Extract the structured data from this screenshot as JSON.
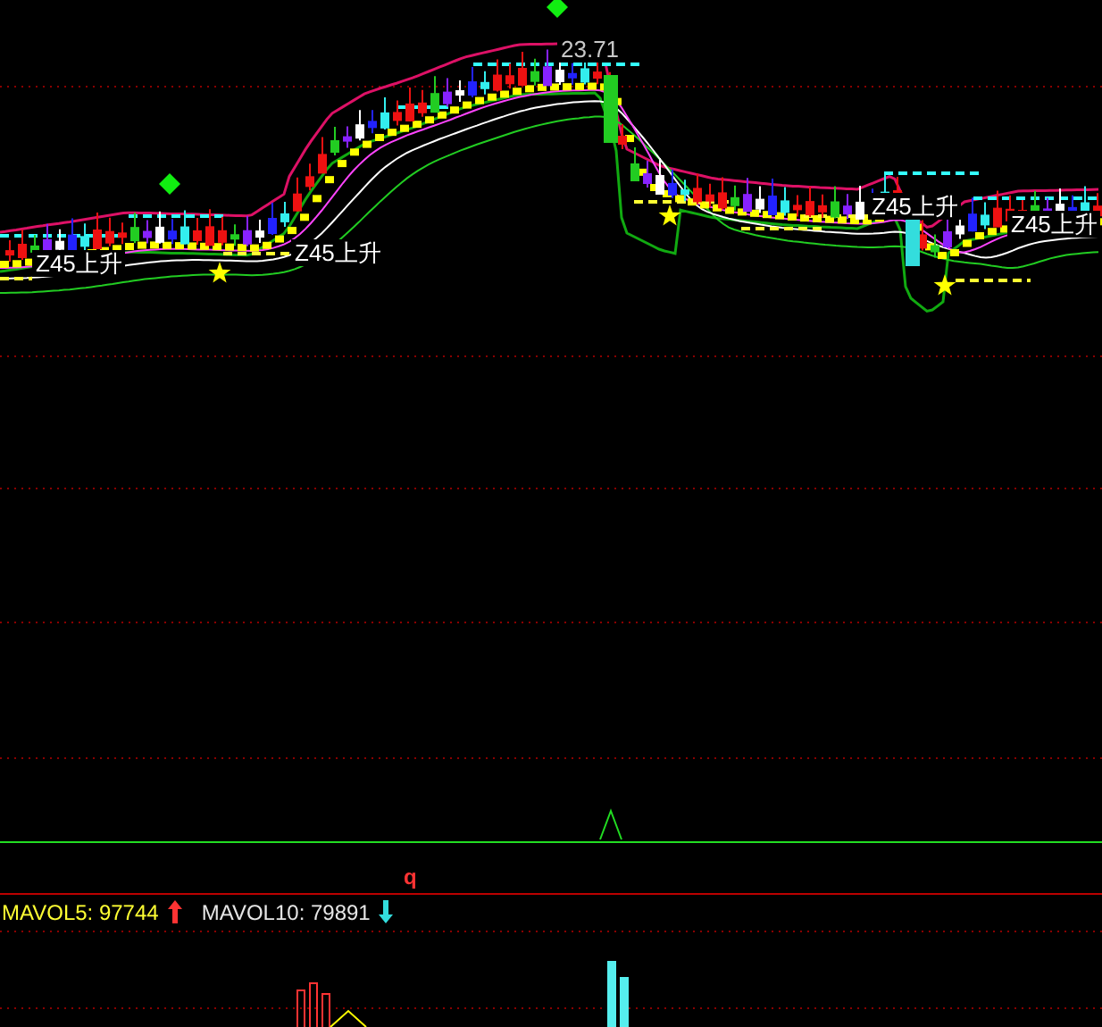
{
  "price_chart": {
    "labels": [
      {
        "kind": "price",
        "text": "23.71"
      },
      {
        "kind": "signal",
        "text": "Z45上升"
      },
      {
        "kind": "signal",
        "text": "Z45上升"
      },
      {
        "kind": "signal",
        "text": "Z45上升"
      },
      {
        "kind": "signal",
        "text": "Z45上升"
      }
    ]
  },
  "indicator": {
    "marker": "q"
  },
  "volume": {
    "legend": [
      {
        "name": "MAVOL5:",
        "value": "97744",
        "rising": true,
        "color": "#ffff33"
      },
      {
        "name": "MAVOL10:",
        "value": "79891",
        "rising": false,
        "color": "#e6e6e6"
      }
    ]
  }
}
